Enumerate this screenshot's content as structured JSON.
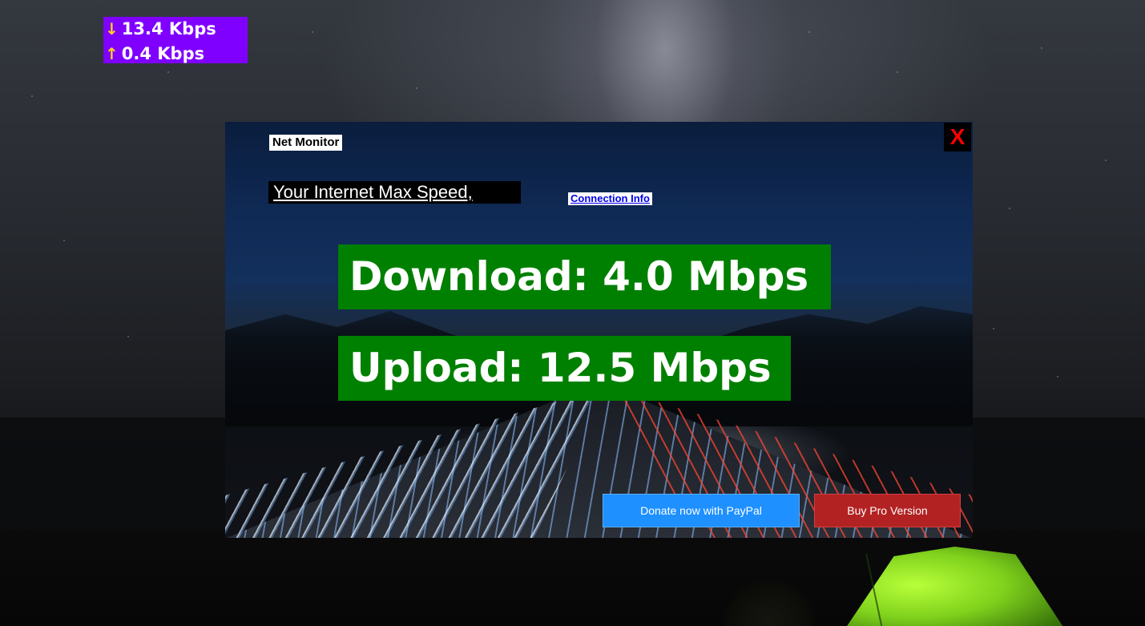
{
  "speed_widget": {
    "download_arrow": "↓",
    "download_rate": "13.4 Kbps",
    "upload_arrow": "↑",
    "upload_rate": "0.4 Kbps",
    "background_color": "#8000ff",
    "arrow_color": "#ffd11a"
  },
  "app": {
    "title": "Net Monitor",
    "close_label": "X",
    "max_speed_label": "Your Internet Max Speed, ",
    "connection_info_link": "Connection Info",
    "download_text": "Download: 4.0 Mbps",
    "upload_text": "Upload: 12.5 Mbps",
    "donate_button": "Donate now with PayPal",
    "buy_button": "Buy Pro Version"
  },
  "colors": {
    "speed_box": "#008000",
    "donate_button": "#1e90ff",
    "buy_button": "#b22222",
    "close_x": "#ff0000"
  }
}
